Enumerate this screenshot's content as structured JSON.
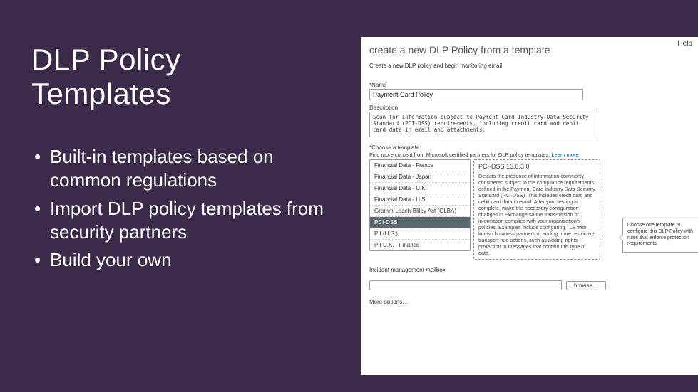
{
  "slide": {
    "title": "DLP Policy Templates",
    "bullets": [
      "Built-in templates based on common regulations",
      "Import DLP policy templates from security partners",
      "Build your own"
    ]
  },
  "app": {
    "help": "Help",
    "title": "create a new DLP Policy from a template",
    "subtitle": "Create a new DLP policy and begin monitoring email",
    "name_label": "Name",
    "name_value": "Payment Card Policy",
    "desc_label": "Description",
    "desc_value": "Scan for information subject to Payment Card Industry Data Security Standard (PCI-DSS) requirements, including credit card and debit card data in email and attachments.",
    "choose_label": "Choose a template:",
    "learn_text": "Find more content from Microsoft certified partners for DLP policy templates.",
    "learn_link": "Learn more",
    "templates": [
      "Financial Data - France",
      "Financial Data - Japan",
      "Financial Data - U.K.",
      "Financial Data - U.S.",
      "Gramm-Leach-Bliley Act (GLBA)",
      "PCI-DSS",
      "PII (U.S.)",
      "PII U.K. - Finance"
    ],
    "selected_index": 5,
    "detail_title": "PCI-DSS  15.0.3.0",
    "detail_body": "Detects the presence of information commonly considered subject to the compliance requirements defined in the Payment Card Industry Data Security Standard (PCI-DSS). This includes credit card and debit card data in email. After your testing is complete, make the necessary configuration changes in Exchange so the transmission of information complies with your organization's policies. Examples include configuring TLS with known business partners or adding more restrictive transport rule actions, such as adding rights protection to messages that contain this type of data.",
    "callout_text": "Choose one template to configure this DLP Policy with rules that enforce protection requirements.",
    "mailbox_label": "Incident management mailbox",
    "browse_label": "browse…",
    "more_options": "More options…"
  }
}
